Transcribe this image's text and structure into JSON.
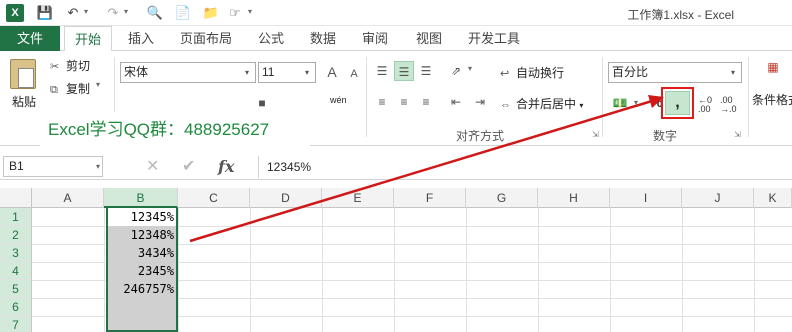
{
  "titlebar": {
    "logo": "X",
    "title": "工作簿1.xlsx - Excel",
    "icons": [
      "excel-logo-icon",
      "save-icon",
      "undo-icon",
      "redo-icon",
      "print-preview-icon",
      "open-folder-icon",
      "touch-mode-icon",
      "customize-qat-icon"
    ]
  },
  "tabs": {
    "file": "文件",
    "items": [
      "开始",
      "插入",
      "页面布局",
      "公式",
      "数据",
      "审阅",
      "视图",
      "开发工具"
    ],
    "active_index": 0
  },
  "ribbon": {
    "clipboard": {
      "paste": "粘贴",
      "cut": "剪切",
      "copy": "复制"
    },
    "font": {
      "name": "宋体",
      "size": "11",
      "grow": "A",
      "shrink": "A"
    },
    "alignment": {
      "wrap_text": "自动换行",
      "merge_center": "合并后居中",
      "merge_arrow": "▾",
      "group_label": "对齐方式",
      "phonetic": "wén",
      "selected_icon": "align-middle-icon"
    },
    "number": {
      "format": "百分比",
      "percent": "%",
      "comma": ",",
      "increase_decimal": "←0 .00",
      "decrease_decimal": ".00 →.0",
      "group_label": "数字",
      "highlight_color": "#e01b1b"
    },
    "styles": {
      "conditional": "条件格式"
    }
  },
  "overlay": {
    "qq_banner": "Excel学习QQ群：488925627"
  },
  "formula_bar": {
    "name_box": "B1",
    "cancel": "✕",
    "enter": "✔",
    "fx": "fx",
    "value": "12345%"
  },
  "grid": {
    "columns": [
      "A",
      "B",
      "C",
      "D",
      "E",
      "F",
      "G",
      "H",
      "I",
      "J",
      "K"
    ],
    "selected_column": "B",
    "rows": [
      "1",
      "2",
      "3",
      "4",
      "5",
      "6",
      "7"
    ],
    "b_values": [
      "12345%",
      "12348%",
      "3434%",
      "2345%",
      "246757%",
      "",
      ""
    ],
    "accent": "#217346",
    "arrow_color": "#d01818"
  }
}
